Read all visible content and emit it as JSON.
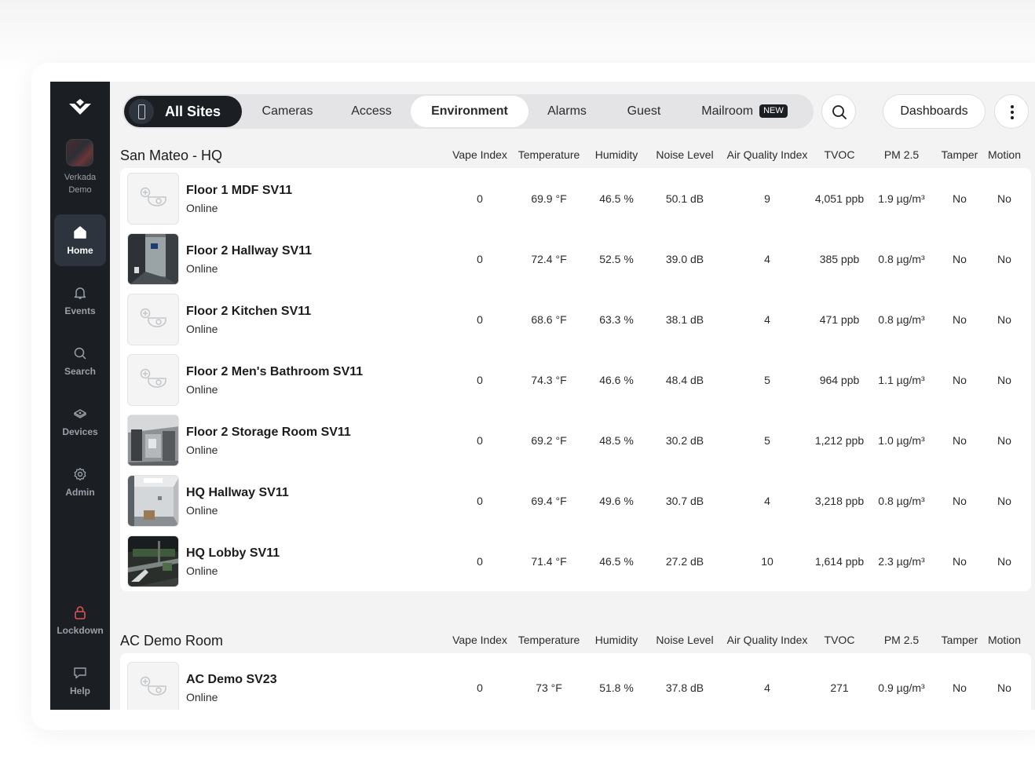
{
  "sidebar": {
    "org_name_line1": "Verkada",
    "org_name_line2": "Demo",
    "items": [
      {
        "label": "Home",
        "icon": "home-icon"
      },
      {
        "label": "Events",
        "icon": "bell-icon"
      },
      {
        "label": "Search",
        "icon": "search-icon"
      },
      {
        "label": "Devices",
        "icon": "devices-icon"
      },
      {
        "label": "Admin",
        "icon": "gear-icon"
      },
      {
        "label": "Lockdown",
        "icon": "lock-icon"
      },
      {
        "label": "Help",
        "icon": "chat-icon"
      }
    ]
  },
  "topbar": {
    "sites_label": "All Sites",
    "tabs": [
      "Cameras",
      "Access",
      "Environment",
      "Alarms",
      "Guest",
      "Mailroom"
    ],
    "active_tab": "Environment",
    "new_badge": "NEW",
    "dashboards_label": "Dashboards"
  },
  "columns": [
    "Vape Index",
    "Temperature",
    "Humidity",
    "Noise Level",
    "Air Quality Index",
    "TVOC",
    "PM 2.5",
    "Tamper",
    "Motion"
  ],
  "sections": [
    {
      "title": "San Mateo - HQ",
      "rows": [
        {
          "name": "Floor 1 MDF SV11",
          "status": "Online",
          "thumb": "placeholder",
          "values": [
            "0",
            "69.9 °F",
            "46.5 %",
            "50.1 dB",
            "9",
            "4,051 ppb",
            "1.9 µg/m³",
            "No",
            "No"
          ]
        },
        {
          "name": "Floor 2 Hallway SV11",
          "status": "Online",
          "thumb": "hallway-door",
          "values": [
            "0",
            "72.4 °F",
            "52.5 %",
            "39.0 dB",
            "4",
            "385 ppb",
            "0.8 µg/m³",
            "No",
            "No"
          ]
        },
        {
          "name": "Floor 2 Kitchen SV11",
          "status": "Online",
          "thumb": "placeholder",
          "values": [
            "0",
            "68.6 °F",
            "63.3 %",
            "38.1 dB",
            "4",
            "471 ppb",
            "0.8 µg/m³",
            "No",
            "No"
          ]
        },
        {
          "name": "Floor 2 Men's Bathroom SV11",
          "status": "Online",
          "thumb": "placeholder",
          "values": [
            "0",
            "74.3 °F",
            "46.6 %",
            "48.4 dB",
            "5",
            "964 ppb",
            "1.1 µg/m³",
            "No",
            "No"
          ]
        },
        {
          "name": "Floor 2 Storage Room SV11",
          "status": "Online",
          "thumb": "storage-room",
          "values": [
            "0",
            "69.2 °F",
            "48.5 %",
            "30.2 dB",
            "5",
            "1,212 ppb",
            "1.0 µg/m³",
            "No",
            "No"
          ]
        },
        {
          "name": "HQ Hallway SV11",
          "status": "Online",
          "thumb": "hq-hallway",
          "values": [
            "0",
            "69.4 °F",
            "49.6 %",
            "30.7 dB",
            "4",
            "3,218 ppb",
            "0.8 µg/m³",
            "No",
            "No"
          ]
        },
        {
          "name": "HQ Lobby SV11",
          "status": "Online",
          "thumb": "hq-lobby",
          "values": [
            "0",
            "71.4 °F",
            "46.5 %",
            "27.2 dB",
            "10",
            "1,614 ppb",
            "2.3 µg/m³",
            "No",
            "No"
          ]
        }
      ]
    },
    {
      "title": "AC Demo Room",
      "rows": [
        {
          "name": "AC Demo SV23",
          "status": "Online",
          "thumb": "placeholder",
          "values": [
            "0",
            "73 °F",
            "51.8 %",
            "37.8 dB",
            "4",
            "271",
            "0.9 µg/m³",
            "No",
            "No"
          ]
        }
      ]
    }
  ]
}
